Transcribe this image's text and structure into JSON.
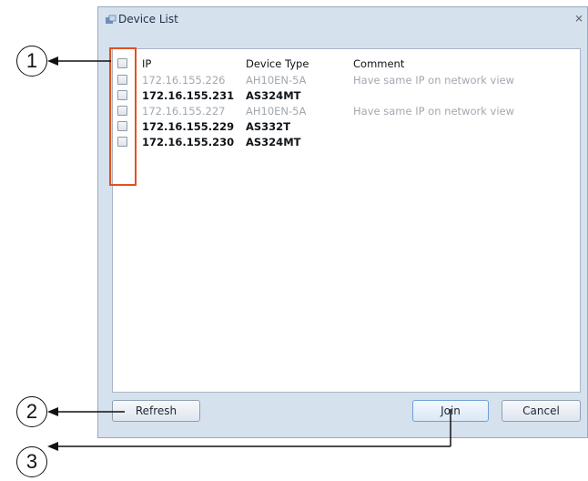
{
  "window": {
    "title": "Device List",
    "close_glyph": "⨯"
  },
  "columns": {
    "ip": "IP",
    "type": "Device Type",
    "comment": "Comment"
  },
  "devices": [
    {
      "ip": "172.16.155.226",
      "type": "AH10EN-5A",
      "comment": "Have same IP on network view",
      "style": "dim"
    },
    {
      "ip": "172.16.155.231",
      "type": "AS324MT",
      "comment": "",
      "style": "bold"
    },
    {
      "ip": "172.16.155.227",
      "type": "AH10EN-5A",
      "comment": "Have same IP on network view",
      "style": "dim"
    },
    {
      "ip": "172.16.155.229",
      "type": "AS332T",
      "comment": "",
      "style": "bold"
    },
    {
      "ip": "172.16.155.230",
      "type": "AS324MT",
      "comment": "",
      "style": "bold"
    }
  ],
  "buttons": {
    "refresh": "Refresh",
    "join": "Join",
    "cancel": "Cancel"
  },
  "callouts": {
    "one": "1",
    "two": "2",
    "three": "3"
  },
  "colors": {
    "highlight": "#e0521f",
    "dialog_bg": "#d6e1ee"
  }
}
